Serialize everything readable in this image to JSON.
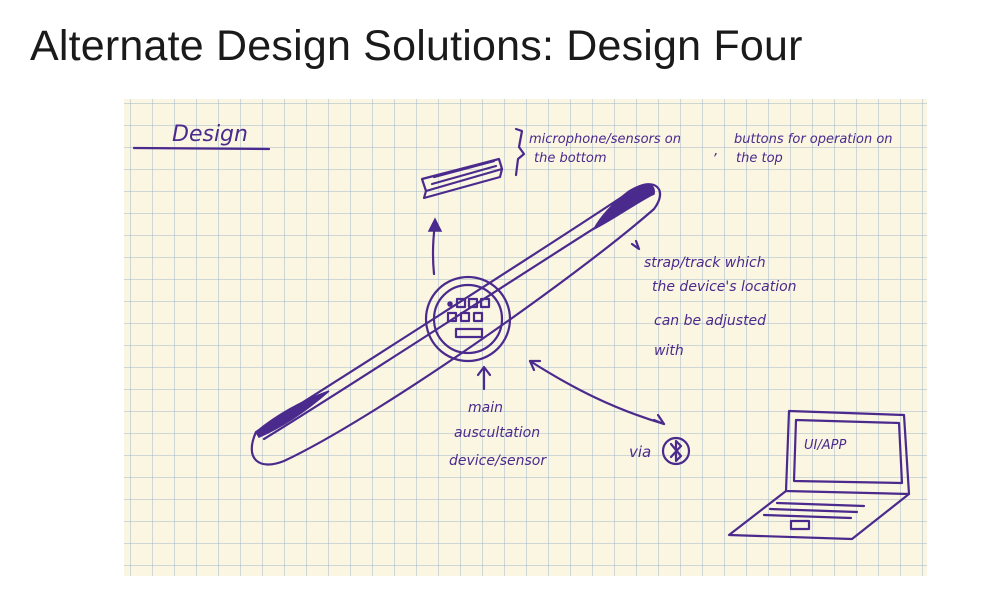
{
  "slide": {
    "title": "Alternate Design Solutions: Design Four"
  },
  "sketch": {
    "heading": "Design",
    "notes": {
      "mic_line1": "microphone/sensors on",
      "mic_line2": "the bottom",
      "buttons_line1": "buttons for operation on",
      "buttons_line2": "the top",
      "strap_line1": "strap/track which",
      "strap_line2": "the device's location",
      "strap_line3": "can be adjusted",
      "strap_line4": "with",
      "main_line1": "main",
      "main_line2": "auscultation",
      "main_line3": "device/sensor",
      "via": "via",
      "screen": "UI/APP"
    },
    "ink_color": "#4a2a8c",
    "icons": [
      "bluetooth-icon",
      "laptop-icon",
      "device-icon"
    ]
  }
}
